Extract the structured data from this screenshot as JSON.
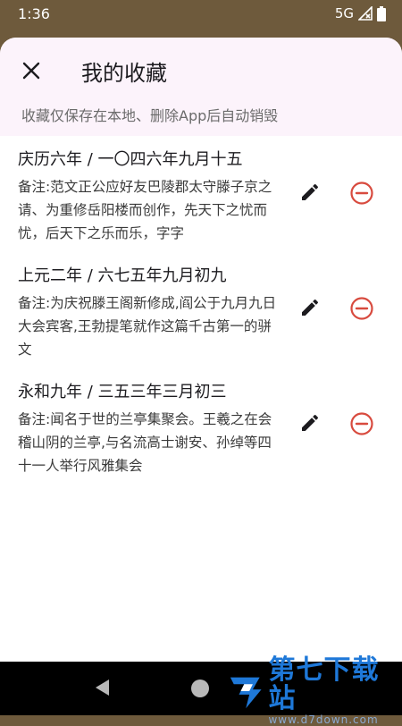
{
  "status_bar": {
    "time": "1:36",
    "network": "5G",
    "icons": [
      "signal-icon",
      "battery-icon"
    ]
  },
  "header": {
    "close_icon": "close-icon",
    "title": "我的收藏",
    "subtitle": "收藏仅保存在本地、删除App后自动销毁"
  },
  "items": [
    {
      "title": "庆历六年 / 一〇四六年九月十五",
      "note": "备注:范文正公应好友巴陵郡太守滕子京之请、为重修岳阳楼而创作，先天下之忧而忧，后天下之乐而乐，字字"
    },
    {
      "title": "上元二年 / 六七五年九月初九",
      "note": "备注:为庆祝滕王阁新修成,阎公于九月九日大会宾客,王勃提笔就作这篇千古第一的骈文"
    },
    {
      "title": "永和九年 / 三五三年三月初三",
      "note": "备注:闻名于世的兰亭集聚会。王羲之在会稽山阴的兰亭,与名流高士谢安、孙绰等四十一人举行风雅集会"
    }
  ],
  "actions": {
    "edit_icon": "pencil-icon",
    "remove_icon": "remove-circle-icon"
  },
  "nav": {
    "back_icon": "back-triangle-icon",
    "home_icon": "home-circle-icon"
  },
  "watermark": {
    "text": "第七下载站",
    "url": "www.d7down.com"
  },
  "colors": {
    "status_bar": "#6e5a3c",
    "header_bg": "#fcf3fb",
    "remove_red": "#d84b3f",
    "watermark_blue": "#1e78d8"
  }
}
